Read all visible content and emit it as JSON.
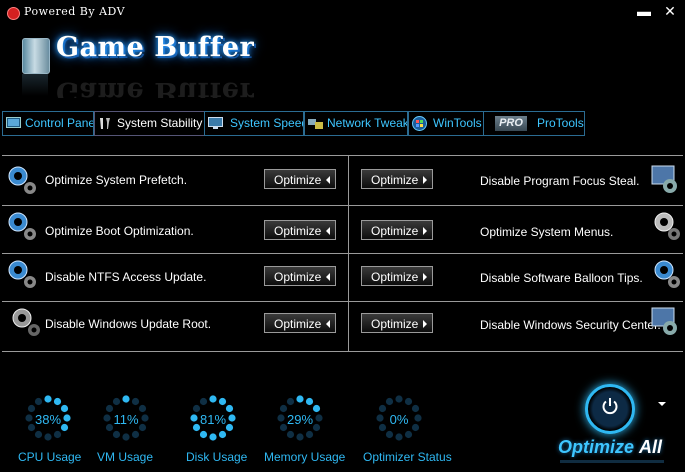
{
  "title_bar": {
    "powered_by": "Powered  By  ADV",
    "minimize": "▬",
    "close": "✕"
  },
  "logo": {
    "title": "Game Buffer"
  },
  "tabs": [
    {
      "label": "Control Panel",
      "icon": "control-panel-icon"
    },
    {
      "label": "System Stability",
      "icon": "tools-icon",
      "active": true
    },
    {
      "label": "System Speed",
      "icon": "monitor-icon"
    },
    {
      "label": "Network Tweak",
      "icon": "network-icon"
    },
    {
      "label": "WinTools",
      "icon": "windows-icon"
    },
    {
      "label": "ProTools",
      "icon": "pro-icon",
      "badge": "PRO"
    }
  ],
  "tweaks_left": [
    {
      "label": "Optimize System Prefetch.",
      "button": "Optimize"
    },
    {
      "label": "Optimize Boot Optimization.",
      "button": "Optimize"
    },
    {
      "label": "Disable NTFS Access Update.",
      "button": "Optimize"
    },
    {
      "label": "Disable Windows Update Root.",
      "button": "Optimize"
    }
  ],
  "tweaks_right": [
    {
      "label": "Disable Program Focus Steal.",
      "button": "Optimize"
    },
    {
      "label": "Optimize System Menus.",
      "button": "Optimize"
    },
    {
      "label": "Disable Software Balloon Tips.",
      "button": "Optimize"
    },
    {
      "label": "Disable Windows Security Center.",
      "button": "Optimize"
    }
  ],
  "stats": [
    {
      "label": "CPU Usage",
      "value": "38%",
      "percent": 38
    },
    {
      "label": "VM  Usage",
      "value": "11%",
      "percent": 11
    },
    {
      "label": "Disk Usage",
      "value": "81%",
      "percent": 81
    },
    {
      "label": "Memory Usage",
      "value": "29%",
      "percent": 29
    },
    {
      "label": "Optimizer Status",
      "value": "0%",
      "percent": 0
    }
  ],
  "optimize_all": {
    "part1": "Optimize",
    "part2": "All"
  },
  "colors": {
    "accent": "#2fb8f2",
    "tab_border": "#2b6c92",
    "divider": "#9a9a9a"
  }
}
